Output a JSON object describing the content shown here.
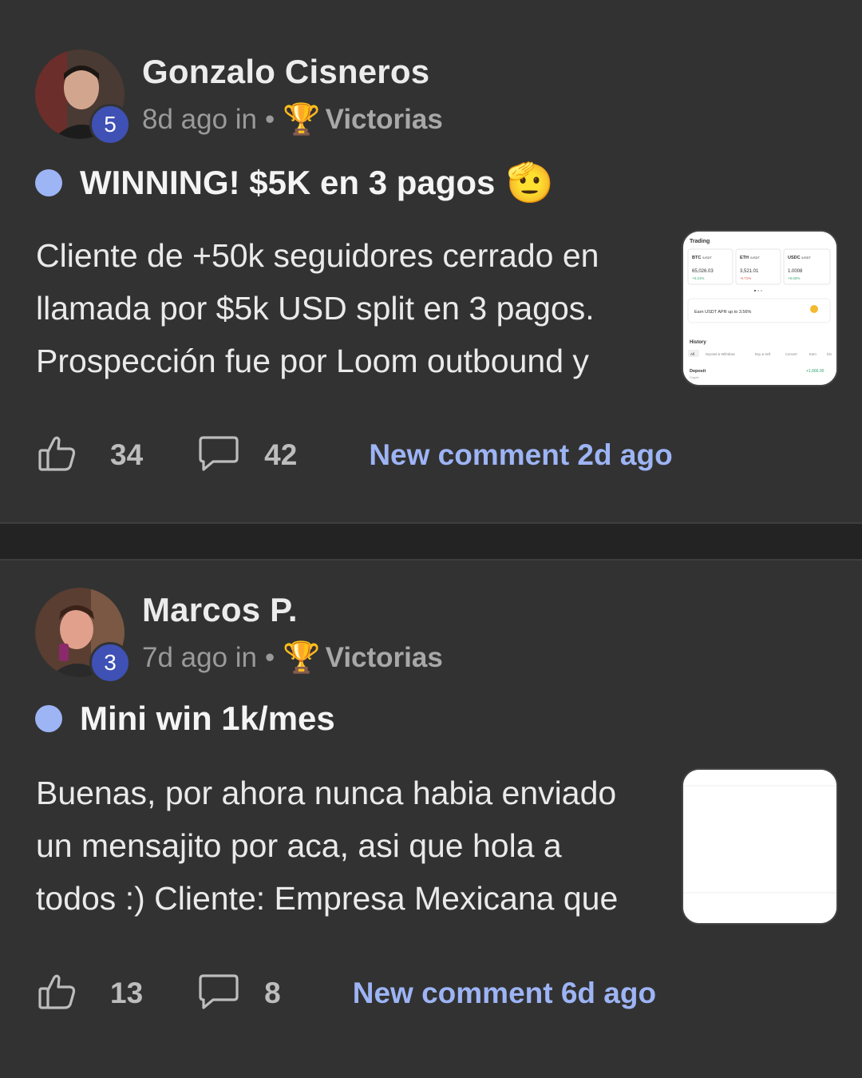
{
  "posts": [
    {
      "author": "Gonzalo Cisneros",
      "level": "5",
      "time_prefix": "8d ago in",
      "separator": "•",
      "category_icon": "trophy-icon",
      "category_emoji": "🏆",
      "category": "Victorias",
      "title": "WINNING! $5K en 3 pagos",
      "title_emoji": "🫡",
      "body": "Cliente de +50k seguidores cerrado en\nllamada por $5k USD split en 3 pagos.\nProspección fue por Loom outbound y",
      "likes": "34",
      "comments": "42",
      "new_comment": "New comment 2d ago",
      "thumbnail": {
        "section": "Trading",
        "pairs": [
          {
            "base": "BTC",
            "quote": "/USDT",
            "price": "65,026.03",
            "change": "+0.21%"
          },
          {
            "base": "ETH",
            "quote": "/USDT",
            "price": "3,521.01",
            "change": "-0.71%"
          },
          {
            "base": "USDC",
            "quote": "/USDT",
            "price": "1.0008",
            "change": "+0.02%"
          }
        ],
        "earn_text": "Earn USDT APR up to 3.56%",
        "history_label": "History",
        "history_tabs": [
          "All",
          "Deposit & Withdraw",
          "Buy & Sell",
          "Convert",
          "Earn",
          "Div"
        ],
        "deposit_label": "Deposit",
        "deposit_sub": "Crypto",
        "deposit_amount": "+1,666.00"
      }
    },
    {
      "author": "Marcos P.",
      "level": "3",
      "time_prefix": "7d ago in",
      "separator": "•",
      "category_icon": "trophy-icon",
      "category_emoji": "🏆",
      "category": "Victorias",
      "title": "Mini win 1k/mes",
      "title_emoji": "",
      "body": "Buenas, por ahora nunca habia enviado\nun mensajito por aca, asi que hola a\ntodos :) Cliente: Empresa Mexicana que",
      "likes": "13",
      "comments": "8",
      "new_comment": "New comment 6d ago"
    }
  ],
  "colors": {
    "background": "#323232",
    "separator": "#232323",
    "accent": "#9db4f5",
    "badge": "#3f51b5"
  }
}
